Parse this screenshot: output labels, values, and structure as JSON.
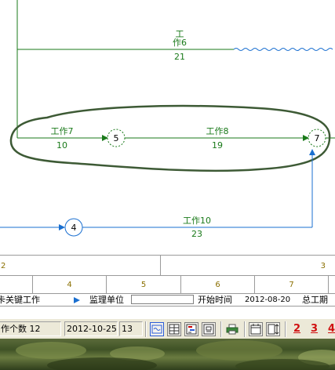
{
  "network": {
    "tasks": [
      {
        "label": "工作6",
        "label_line1": "工",
        "label_line2": "作6",
        "duration": "21"
      },
      {
        "label": "工作7",
        "duration": "10"
      },
      {
        "label": "工作8",
        "duration": "19"
      },
      {
        "label": "工作10",
        "duration": "23"
      }
    ],
    "nodes": [
      "5",
      "7",
      "4"
    ],
    "colors": {
      "critical": "#1a7a1a",
      "normal": "#1a6fd0",
      "node_fill": "#ffffff",
      "highlight": "#3d5a35"
    }
  },
  "timescale": {
    "row1": [
      "2",
      "3"
    ],
    "row2": [
      "4",
      "5",
      "6",
      "7"
    ]
  },
  "info_row": {
    "item1": "卡关键工作",
    "item2": "监理单位",
    "item3": "开始时间",
    "item4": "2012-08-20",
    "item5": "总工期"
  },
  "status_bar": {
    "task_count": "作个数 12",
    "date": "2012-10-25",
    "day": "13",
    "nums": [
      "2",
      "3",
      "4"
    ]
  }
}
